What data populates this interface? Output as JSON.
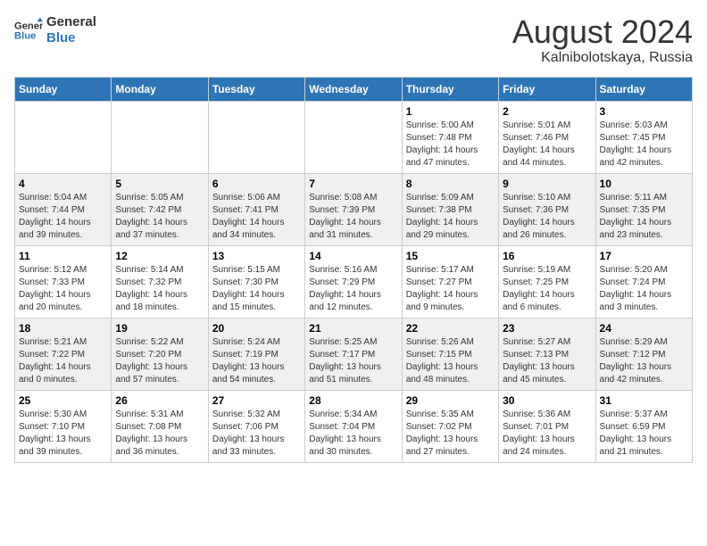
{
  "header": {
    "logo_line1": "General",
    "logo_line2": "Blue",
    "title": "August 2024",
    "subtitle": "Kalnibolotskaya, Russia"
  },
  "weekdays": [
    "Sunday",
    "Monday",
    "Tuesday",
    "Wednesday",
    "Thursday",
    "Friday",
    "Saturday"
  ],
  "weeks": [
    [
      {
        "day": "",
        "info": ""
      },
      {
        "day": "",
        "info": ""
      },
      {
        "day": "",
        "info": ""
      },
      {
        "day": "",
        "info": ""
      },
      {
        "day": "1",
        "info": "Sunrise: 5:00 AM\nSunset: 7:48 PM\nDaylight: 14 hours\nand 47 minutes."
      },
      {
        "day": "2",
        "info": "Sunrise: 5:01 AM\nSunset: 7:46 PM\nDaylight: 14 hours\nand 44 minutes."
      },
      {
        "day": "3",
        "info": "Sunrise: 5:03 AM\nSunset: 7:45 PM\nDaylight: 14 hours\nand 42 minutes."
      }
    ],
    [
      {
        "day": "4",
        "info": "Sunrise: 5:04 AM\nSunset: 7:44 PM\nDaylight: 14 hours\nand 39 minutes."
      },
      {
        "day": "5",
        "info": "Sunrise: 5:05 AM\nSunset: 7:42 PM\nDaylight: 14 hours\nand 37 minutes."
      },
      {
        "day": "6",
        "info": "Sunrise: 5:06 AM\nSunset: 7:41 PM\nDaylight: 14 hours\nand 34 minutes."
      },
      {
        "day": "7",
        "info": "Sunrise: 5:08 AM\nSunset: 7:39 PM\nDaylight: 14 hours\nand 31 minutes."
      },
      {
        "day": "8",
        "info": "Sunrise: 5:09 AM\nSunset: 7:38 PM\nDaylight: 14 hours\nand 29 minutes."
      },
      {
        "day": "9",
        "info": "Sunrise: 5:10 AM\nSunset: 7:36 PM\nDaylight: 14 hours\nand 26 minutes."
      },
      {
        "day": "10",
        "info": "Sunrise: 5:11 AM\nSunset: 7:35 PM\nDaylight: 14 hours\nand 23 minutes."
      }
    ],
    [
      {
        "day": "11",
        "info": "Sunrise: 5:12 AM\nSunset: 7:33 PM\nDaylight: 14 hours\nand 20 minutes."
      },
      {
        "day": "12",
        "info": "Sunrise: 5:14 AM\nSunset: 7:32 PM\nDaylight: 14 hours\nand 18 minutes."
      },
      {
        "day": "13",
        "info": "Sunrise: 5:15 AM\nSunset: 7:30 PM\nDaylight: 14 hours\nand 15 minutes."
      },
      {
        "day": "14",
        "info": "Sunrise: 5:16 AM\nSunset: 7:29 PM\nDaylight: 14 hours\nand 12 minutes."
      },
      {
        "day": "15",
        "info": "Sunrise: 5:17 AM\nSunset: 7:27 PM\nDaylight: 14 hours\nand 9 minutes."
      },
      {
        "day": "16",
        "info": "Sunrise: 5:19 AM\nSunset: 7:25 PM\nDaylight: 14 hours\nand 6 minutes."
      },
      {
        "day": "17",
        "info": "Sunrise: 5:20 AM\nSunset: 7:24 PM\nDaylight: 14 hours\nand 3 minutes."
      }
    ],
    [
      {
        "day": "18",
        "info": "Sunrise: 5:21 AM\nSunset: 7:22 PM\nDaylight: 14 hours\nand 0 minutes."
      },
      {
        "day": "19",
        "info": "Sunrise: 5:22 AM\nSunset: 7:20 PM\nDaylight: 13 hours\nand 57 minutes."
      },
      {
        "day": "20",
        "info": "Sunrise: 5:24 AM\nSunset: 7:19 PM\nDaylight: 13 hours\nand 54 minutes."
      },
      {
        "day": "21",
        "info": "Sunrise: 5:25 AM\nSunset: 7:17 PM\nDaylight: 13 hours\nand 51 minutes."
      },
      {
        "day": "22",
        "info": "Sunrise: 5:26 AM\nSunset: 7:15 PM\nDaylight: 13 hours\nand 48 minutes."
      },
      {
        "day": "23",
        "info": "Sunrise: 5:27 AM\nSunset: 7:13 PM\nDaylight: 13 hours\nand 45 minutes."
      },
      {
        "day": "24",
        "info": "Sunrise: 5:29 AM\nSunset: 7:12 PM\nDaylight: 13 hours\nand 42 minutes."
      }
    ],
    [
      {
        "day": "25",
        "info": "Sunrise: 5:30 AM\nSunset: 7:10 PM\nDaylight: 13 hours\nand 39 minutes."
      },
      {
        "day": "26",
        "info": "Sunrise: 5:31 AM\nSunset: 7:08 PM\nDaylight: 13 hours\nand 36 minutes."
      },
      {
        "day": "27",
        "info": "Sunrise: 5:32 AM\nSunset: 7:06 PM\nDaylight: 13 hours\nand 33 minutes."
      },
      {
        "day": "28",
        "info": "Sunrise: 5:34 AM\nSunset: 7:04 PM\nDaylight: 13 hours\nand 30 minutes."
      },
      {
        "day": "29",
        "info": "Sunrise: 5:35 AM\nSunset: 7:02 PM\nDaylight: 13 hours\nand 27 minutes."
      },
      {
        "day": "30",
        "info": "Sunrise: 5:36 AM\nSunset: 7:01 PM\nDaylight: 13 hours\nand 24 minutes."
      },
      {
        "day": "31",
        "info": "Sunrise: 5:37 AM\nSunset: 6:59 PM\nDaylight: 13 hours\nand 21 minutes."
      }
    ]
  ]
}
